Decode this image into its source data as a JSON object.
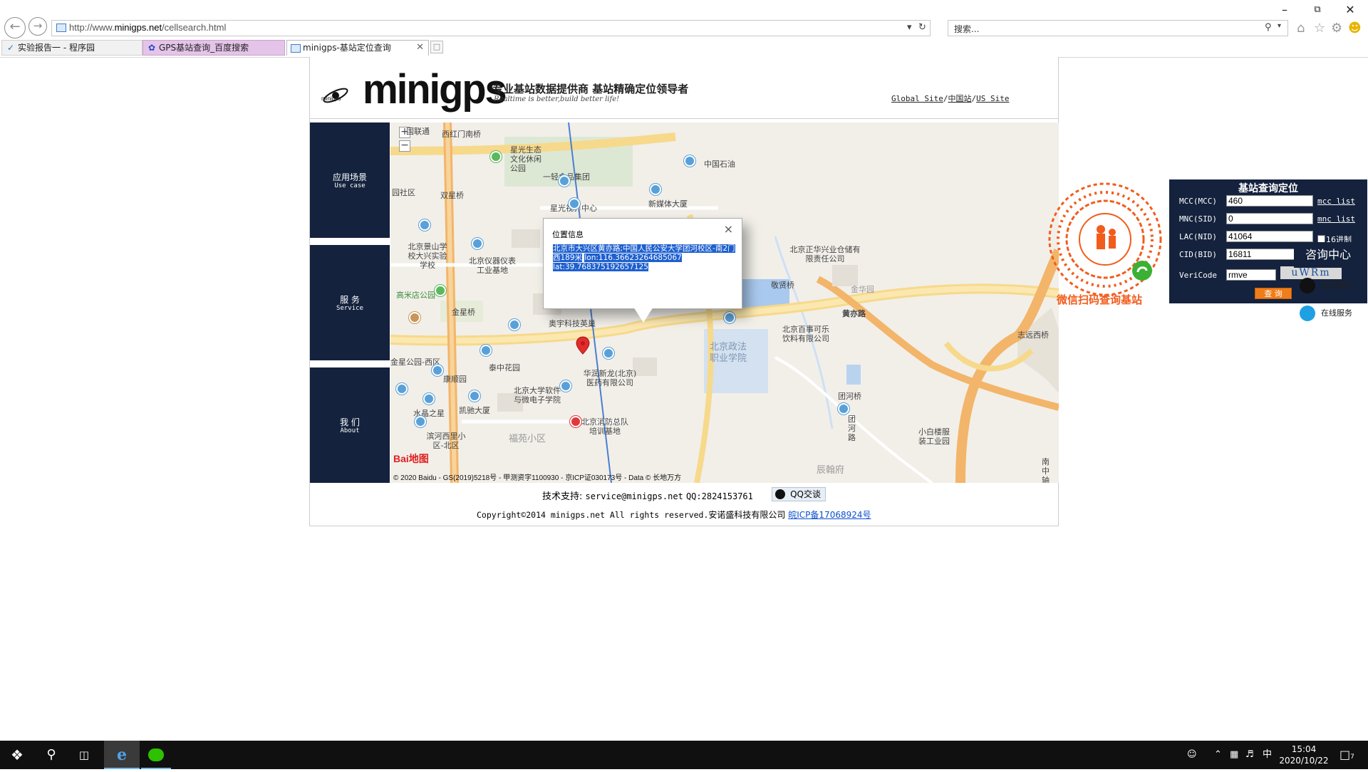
{
  "browser": {
    "url_prefix": "http://www.",
    "url_domain": "minigps.net",
    "url_path": "/cellsearch.html",
    "search_placeholder": "搜索...",
    "tabs": [
      {
        "label": "实验报告一 - 程序园"
      },
      {
        "label": "GPS基站查询_百度搜索"
      },
      {
        "label": "minigps-基站定位查询"
      }
    ]
  },
  "header": {
    "logo_text": "minigps",
    "logo_small": "minigps",
    "slogan": "专业基站数据提供商 基站精确定位领导者",
    "subslogan": "Realtime is better,build better life!",
    "site_links": [
      "Global Site",
      "中国站",
      "US Site"
    ],
    "separator": "/"
  },
  "nav": [
    {
      "zh": "应用场景",
      "en": "Use case"
    },
    {
      "zh": "服 务",
      "en": "Service"
    },
    {
      "zh": "我 们",
      "en": "About"
    }
  ],
  "map": {
    "popup_title": "位置信息",
    "popup_close": "×",
    "popup_address": "北京市大兴区黄亦路;中国人民公安大学团河校区-南2门西189米",
    "popup_lon": "lon:116.36623264685067",
    "popup_lat": "lat:39.768375192657125",
    "zoom_in": "+",
    "zoom_out": "−",
    "copyright": "© 2020 Baidu - GS(2019)5218号 - 甲测资字1100930 - 京ICP证030173号 - Data © 长地万方",
    "baidu_logo": "Bai地图",
    "labels": [
      "国联通",
      "西红门南桥",
      "星光生态文化休闲公园",
      "中国石油",
      "园社区",
      "一轻食品集团",
      "双星桥",
      "新媒体大厦",
      "星光视界中心",
      "北京景山学校大兴实验学校",
      "北京仪器仪表工业基地",
      "北京正华兴业仓储有限责任公司",
      "高米店公园",
      "金星桥",
      "奥宇科技英巢",
      "敬贤桥",
      "金华园",
      "黄亦路",
      "北京百事可乐饮料有限公司",
      "金星公园-西区",
      "泰中花园",
      "北京政法职业学院",
      "华润新龙(北京)医药有限公司",
      "康顺园",
      "北京大学软件与微电子学院",
      "团河桥",
      "志远西桥",
      "水晶之星",
      "凯驰大厦",
      "团河路",
      "北京消防总队培训基地",
      "小白楼服装工业园",
      "滨河西里小区-北区",
      "福苑小区",
      "辰翰府",
      "南中轴"
    ]
  },
  "qr": {
    "caption": "微信扫码查询基站"
  },
  "query": {
    "title": "基站查询定位",
    "mcc_label": "MCC(MCC)",
    "mcc_value": "460",
    "mnc_label": "MNC(SID)",
    "mnc_value": "0",
    "lac_label": "LAC(NID)",
    "lac_value": "41064",
    "cid_label": "CID(BID)",
    "cid_value": "16811",
    "vericode_label": "VeriCode",
    "vericode_value": "rmve",
    "captcha_text": "uWRm",
    "mcc_link": "mcc list",
    "mnc_link": "mnc list",
    "hex_label": "16进制",
    "hex_checked": false,
    "submit_label": "查 询"
  },
  "footer": {
    "support_label": "技术支持:",
    "support_email": "service@minigps.net",
    "support_qq": "QQ:2824153761",
    "qq_chat_label": "QQ交谈",
    "copyright": "Copyright©2014 minigps.net All rights reserved.",
    "company": "安诺盛科技有限公司",
    "icp": "皖ICP备17068924号"
  },
  "consult": {
    "title": "咨询中心",
    "items": [
      {
        "label": "在线服务",
        "icon": "qq-icon"
      },
      {
        "label": "在线服务",
        "icon": "skype-icon"
      }
    ]
  },
  "taskbar": {
    "time": "15:04",
    "date": "2020/10/22",
    "ime": "中",
    "notification_count": "7"
  },
  "colors": {
    "nav_bg": "#14223d",
    "accent_orange": "#ef7d1a",
    "selection_blue": "#1d5fcf",
    "qr_orange": "#f25c1c"
  }
}
